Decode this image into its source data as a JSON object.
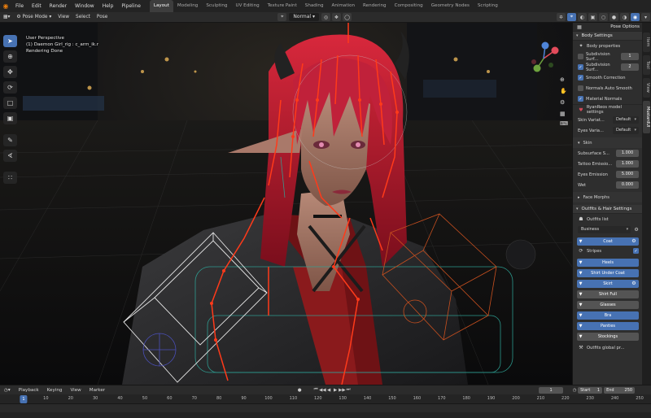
{
  "topbar": {
    "menus": [
      "File",
      "Edit",
      "Render",
      "Window",
      "Help",
      "Pipeline"
    ],
    "workspaces": [
      "Layout",
      "Modeling",
      "Sculpting",
      "UV Editing",
      "Texture Paint",
      "Shading",
      "Animation",
      "Rendering",
      "Compositing",
      "Geometry Nodes",
      "Scripting"
    ],
    "active_workspace": "Layout"
  },
  "viewport_header": {
    "mode": "Pose Mode",
    "menus": [
      "View",
      "Select",
      "Pose"
    ],
    "orientation": "Normal",
    "pose_options": "Pose Options"
  },
  "viewport_info": {
    "line1": "User Perspective",
    "line2": "(1) Daemon Girl_rig : c_arm_ik.r",
    "line3": "Rendering Done"
  },
  "npanel": {
    "tabs": [
      "Item",
      "Tool",
      "View",
      "MustardUI"
    ],
    "body_settings": {
      "title": "Body Settings",
      "body_properties": "Body properties",
      "subdiv_surf_1": {
        "label": "Subdivision Surf...",
        "value": "1",
        "checked": false
      },
      "subdiv_surf_2": {
        "label": "Subdivision Surf...",
        "value": "2",
        "checked": true
      },
      "smooth_correction": {
        "label": "Smooth Correction",
        "checked": true
      },
      "normals_auto_smooth": {
        "label": "Normals Auto Smooth",
        "checked": false
      },
      "material_normals": {
        "label": "Material Normals",
        "checked": true
      },
      "model_settings": "RyanReos model settings",
      "skin_variation": {
        "label": "Skin Variat...",
        "value": "Default"
      },
      "eyes_variation": {
        "label": "Eyes Varia...",
        "value": "Default"
      },
      "skin_title": "Skin",
      "subsurface": {
        "label": "Subsurface S...",
        "value": "1.000"
      },
      "tattoo_emission": {
        "label": "Tattoo Emissio...",
        "value": "1.000"
      },
      "eyes_emission": {
        "label": "Eyes Emission",
        "value": "5.000"
      },
      "wet": {
        "label": "Wet",
        "value": "0.000"
      },
      "face_morphs": "Face Morphs"
    },
    "outfits": {
      "title": "Outfits & Hair Settings",
      "outfits_list": "Outfits list",
      "selected_outfit": "Business",
      "items": [
        {
          "label": "Coat",
          "state": "on",
          "gear": true
        },
        {
          "label": "Stripes",
          "state": "plain"
        },
        {
          "label": "Heels",
          "state": "on"
        },
        {
          "label": "Shirt Under Coat",
          "state": "on"
        },
        {
          "label": "Skirt",
          "state": "on",
          "gear": true
        },
        {
          "label": "Shirt Full",
          "state": "off"
        },
        {
          "label": "Glasses",
          "state": "off"
        },
        {
          "label": "Bra",
          "state": "on"
        },
        {
          "label": "Panties",
          "state": "on"
        },
        {
          "label": "Stockings",
          "state": "off"
        }
      ],
      "global_props": "Outfits global pr..."
    }
  },
  "timeline": {
    "menus": [
      "Playback",
      "Keying",
      "View",
      "Marker"
    ],
    "current_frame": "1",
    "start_label": "Start",
    "start_value": "1",
    "end_label": "End",
    "end_value": "250",
    "ticks": [
      "1",
      "10",
      "20",
      "30",
      "40",
      "50",
      "60",
      "70",
      "80",
      "90",
      "100",
      "110",
      "120",
      "130",
      "140",
      "150",
      "160",
      "170",
      "180",
      "190",
      "200",
      "210",
      "220",
      "230",
      "240",
      "250"
    ]
  },
  "colors": {
    "accent": "#4772b3",
    "bone": "#ff3a1a",
    "rig_teal": "#2fa79a",
    "rig_orange": "#c8501f"
  }
}
